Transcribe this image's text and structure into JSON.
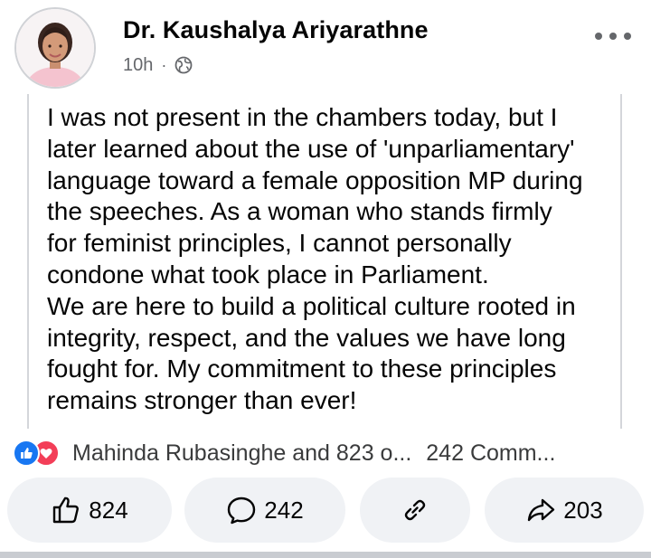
{
  "post": {
    "author": "Dr. Kaushalya Ariyarathne",
    "time": "10h",
    "separator": "·",
    "privacy_icon": "globe-icon",
    "menu_icon": "more-horizontal-icon",
    "body_lines": [
      "I was not present in the chambers today, but I",
      "later learned about the use of 'unparliamentary'",
      "language toward a female opposition MP during",
      "the speeches. As a woman who stands firmly",
      "for feminist principles, I cannot personally",
      "condone what took place in Parliament.",
      "We are here to build a political culture rooted in",
      "integrity, respect, and the values we have long",
      "fought for. My commitment to these principles",
      "remains stronger than ever!"
    ]
  },
  "reactions": {
    "icons": [
      "like-reaction-icon",
      "love-reaction-icon"
    ],
    "names_text": "Mahinda Rubasinghe and 823 o...",
    "comments_text": "242 Comm..."
  },
  "actions": {
    "like_count": "824",
    "comment_count": "242",
    "share_count": "203"
  },
  "colors": {
    "like_blue": "#1877f2",
    "love_red": "#f33e58",
    "button_bg": "#f0f2f5",
    "secondary_text": "#65676b"
  }
}
